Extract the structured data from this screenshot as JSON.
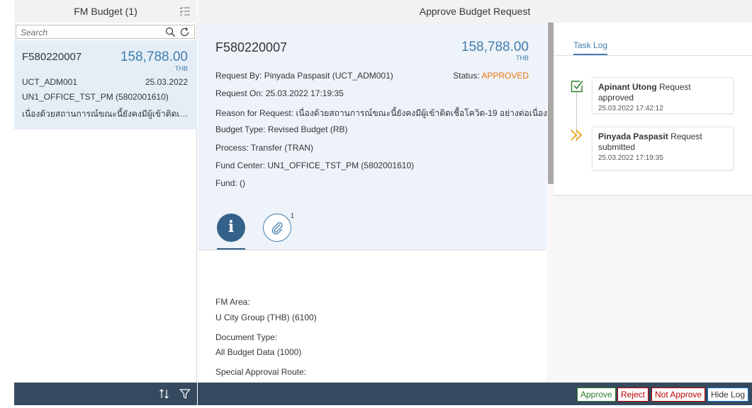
{
  "master": {
    "title": "FM Budget (1)",
    "search_placeholder": "Search",
    "item": {
      "id": "F580220007",
      "amount": "158,788.00",
      "currency": "THB",
      "user": "UCT_ADM001",
      "date": "25.03.2022",
      "fund_center": "UN1_OFFICE_TST_PM (5802001610)",
      "reason": "เนื่องด้วยสถานการณ์ขณะนี้ยังคงมีผู้เข้าติดเชื้อโ..."
    }
  },
  "detail": {
    "title": "Approve Budget Request",
    "id": "F580220007",
    "amount": "158,788.00",
    "currency": "THB",
    "status_label": "Status:",
    "status_value": "APPROVED",
    "attributes": [
      {
        "text": "Request By: Pinyada Paspasit (UCT_ADM001)"
      },
      {
        "text": "Request On: 25.03.2022 17:19:35"
      },
      {
        "text": "Reason for Request: เนื่องด้วยสถานการณ์ขณะนี้ยังคงมีผู้เข้าติดเชื้อโควิด-19 อย่างต่อเนื่อง"
      },
      {
        "text": "Budget Type: Revised Budget (RB)"
      },
      {
        "text": "Process: Transfer (TRAN)"
      },
      {
        "text": "Fund Center: UN1_OFFICE_TST_PM (5802001610)"
      },
      {
        "text": "Fund:  ()"
      }
    ],
    "info_tab_glyph": "i",
    "attachments_count": "1",
    "fields": [
      {
        "label": "FM Area:",
        "value": "U City Group (THB) (6100)"
      },
      {
        "label": "Document Type:",
        "value": "All Budget Data (1000)"
      },
      {
        "label": "Special Approval Route:",
        "value": ""
      }
    ]
  },
  "tasklog": {
    "tab_label": "Task Log",
    "entries": [
      {
        "name": "Apinant Utong",
        "action": "Request approved",
        "time": "25.03.2022 17:42:12",
        "icon": "checkbox-approved-icon"
      },
      {
        "name": "Pinyada Paspasit",
        "action": "Request submitted",
        "time": "25.03.2022 17:19:35",
        "icon": "double-chevron-submit-icon"
      }
    ]
  },
  "footer": {
    "approve": "Approve",
    "reject": "Reject",
    "not_approve": "Not Approve",
    "hide_log": "Hide Log"
  },
  "colors": {
    "accent": "#427cac",
    "status_approved": "#e9730c",
    "footer_bg": "#354a5f",
    "approve": "#2b7d2b",
    "reject": "#bb0000"
  }
}
